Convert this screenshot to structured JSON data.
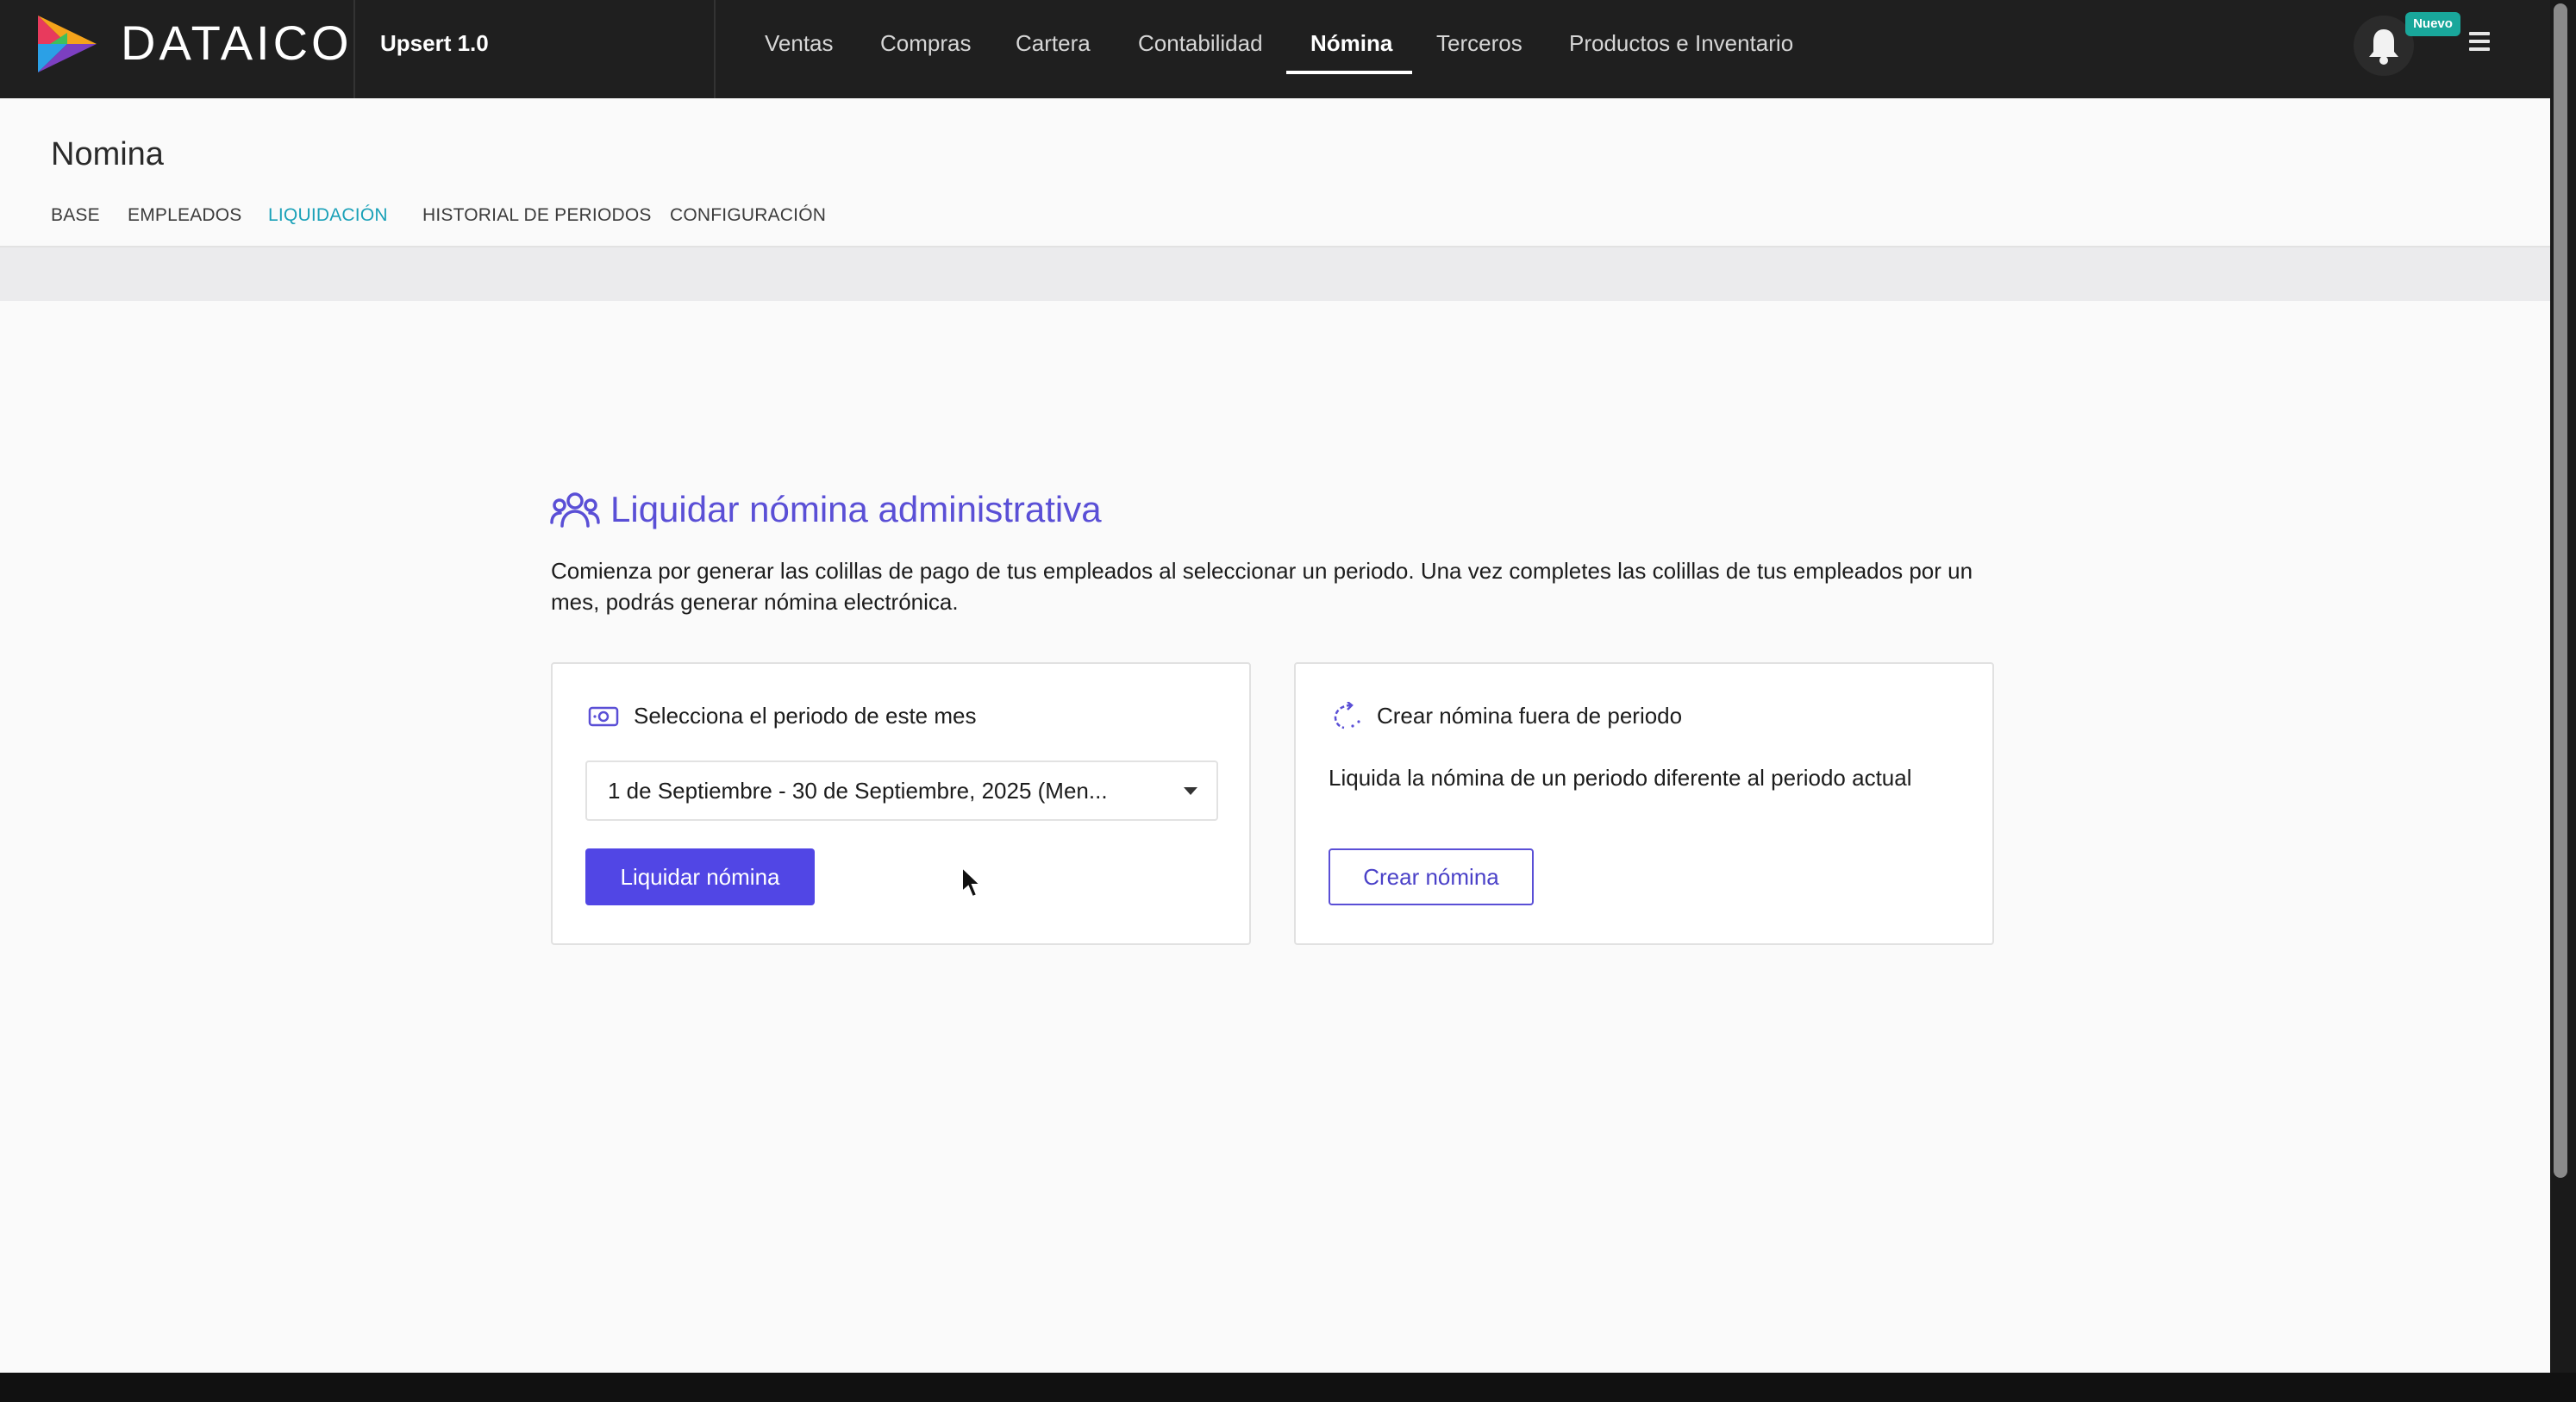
{
  "header": {
    "brand": "DATAICO",
    "company": "Upsert 1.0",
    "nav": [
      "Ventas",
      "Compras",
      "Cartera",
      "Contabilidad",
      "Nómina",
      "Terceros",
      "Productos e Inventario"
    ],
    "active_nav": "Nómina",
    "badge": "Nuevo"
  },
  "page": {
    "title": "Nomina",
    "tabs": [
      "BASE",
      "EMPLEADOS",
      "LIQUIDACIÓN",
      "HISTORIAL DE PERIODOS",
      "CONFIGURACIÓN"
    ],
    "active_tab": "LIQUIDACIÓN"
  },
  "main": {
    "title": "Liquidar nómina administrativa",
    "description": "Comienza por generar las colillas de pago de tus empleados al seleccionar un periodo. Una vez completes las colillas de tus empleados por un mes, podrás generar nómina electrónica.",
    "left_card": {
      "title": "Selecciona el periodo de este mes",
      "period_value": "1 de Septiembre - 30 de Septiembre, 2025 (Men...",
      "button": "Liquidar nómina"
    },
    "right_card": {
      "title": "Crear nómina fuera de periodo",
      "description": "Liquida la nómina de un periodo diferente al periodo actual",
      "button": "Crear nómina"
    }
  },
  "colors": {
    "accent": "#5146e5",
    "active_tab": "#1aa1b8",
    "badge": "#19a79b",
    "topbar": "#1f1f1f"
  },
  "icons": {
    "logo": "dataico-logo-icon",
    "notifications": "bell-icon",
    "menu": "hamburger-menu-icon",
    "section": "users-group-icon",
    "left_card": "money-icon",
    "right_card": "refresh-dashed-icon",
    "select": "caret-down-icon"
  }
}
